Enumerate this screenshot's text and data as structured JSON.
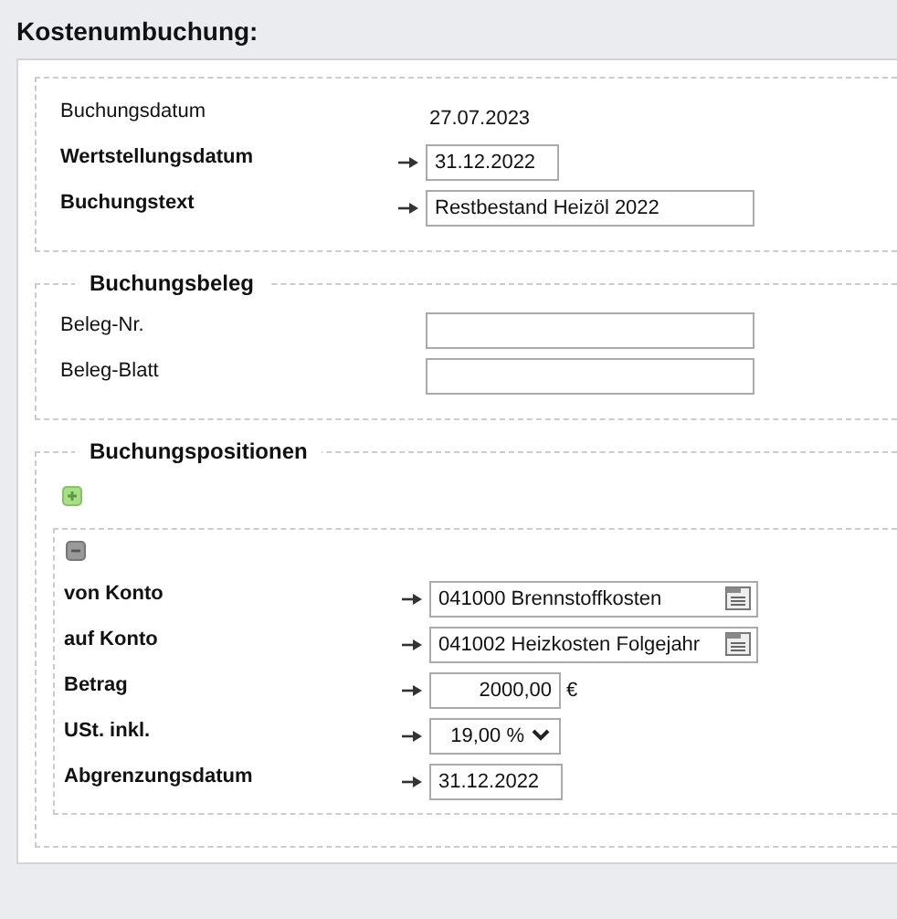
{
  "title": "Kostenumbuchung:",
  "sections": [
    {
      "fields": [
        {
          "kind": "static",
          "label": "Buchungsdatum",
          "required": false,
          "value": "27.07.2023"
        },
        {
          "kind": "date",
          "label": "Wertstellungsdatum",
          "required": true,
          "value": "31.12.2022"
        },
        {
          "kind": "text",
          "label": "Buchungstext",
          "required": true,
          "value": "Restbestand Heizöl 2022"
        }
      ]
    },
    {
      "legend": "Buchungsbeleg",
      "fields": [
        {
          "kind": "text",
          "label": "Beleg-Nr.",
          "required": false
        },
        {
          "kind": "text",
          "label": "Beleg-Blatt",
          "required": false
        }
      ]
    }
  ],
  "positions": {
    "legend": "Buchungspositionen",
    "items": [
      {
        "fields": [
          {
            "kind": "lookup",
            "label": "von Konto",
            "required": true,
            "value": "041000 Brennstoffkosten"
          },
          {
            "kind": "lookup",
            "label": "auf Konto",
            "required": true,
            "value": "041002 Heizkosten Folgejahr"
          },
          {
            "kind": "amount",
            "label": "Betrag",
            "required": true,
            "value": "2000,00",
            "unit": "€"
          },
          {
            "kind": "select",
            "label": "USt. inkl.",
            "required": true,
            "value": "19,00 %"
          },
          {
            "kind": "date",
            "label": "Abgrenzungsdatum",
            "required": true,
            "value": "31.12.2022"
          }
        ]
      }
    ]
  }
}
